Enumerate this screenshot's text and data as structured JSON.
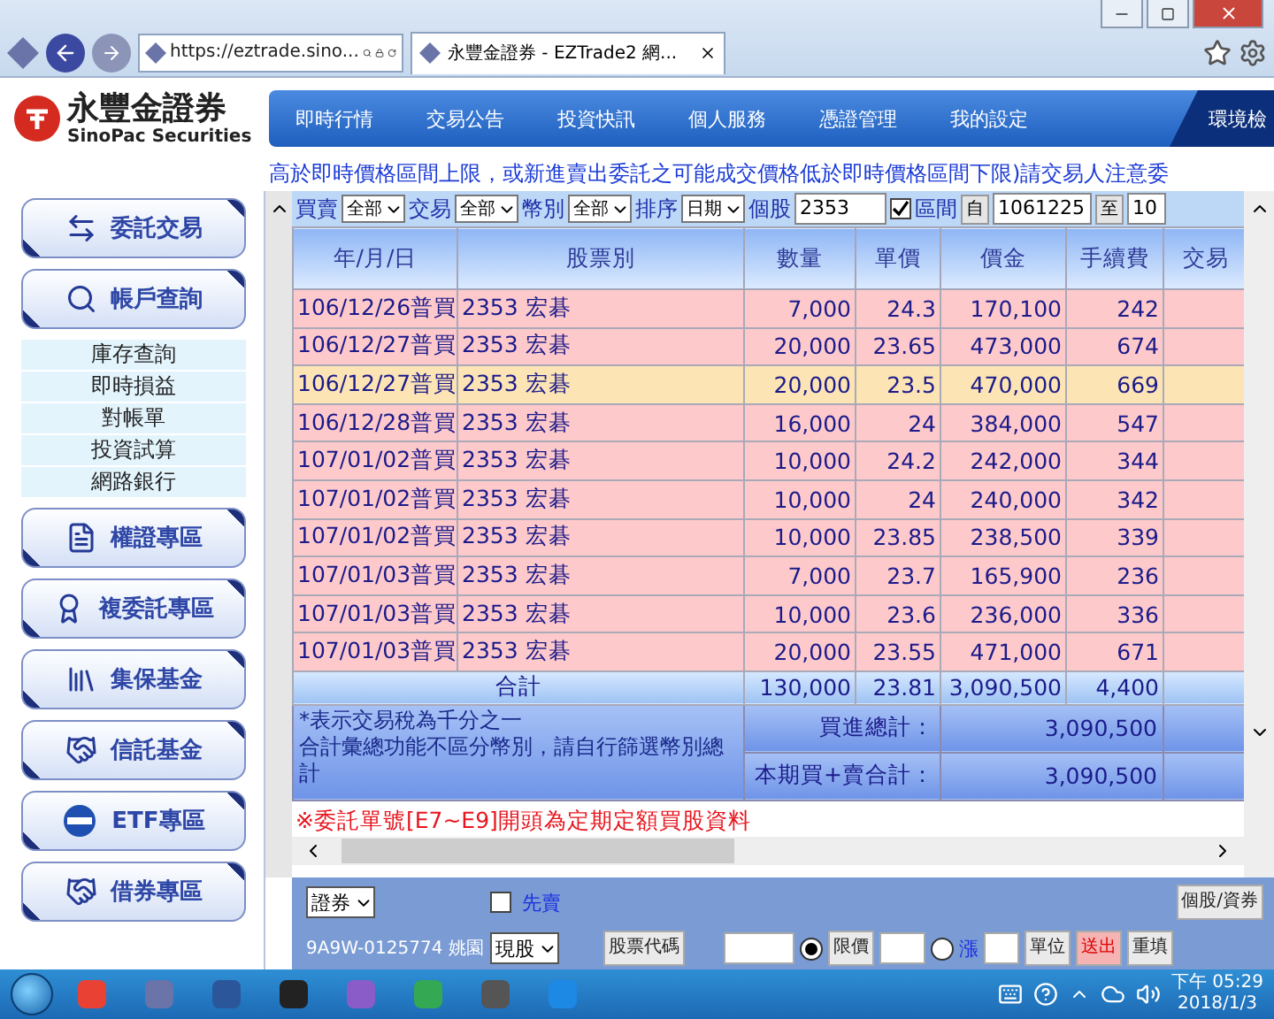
{
  "browser": {
    "url": "https://eztrade.sino...",
    "tab": "永豐金證券 - EZTrade2 網..."
  },
  "logo": {
    "name": "永豐金證券",
    "subtitle": "SinoPac Securities"
  },
  "nav": [
    {
      "label": "即時行情",
      "selected": false
    },
    {
      "label": "交易公告",
      "selected": false
    },
    {
      "label": "投資快訊",
      "selected": false
    },
    {
      "label": "個人服務",
      "selected": false
    },
    {
      "label": "憑證管理",
      "selected": false
    },
    {
      "label": "我的設定",
      "selected": false
    },
    {
      "label": "環境檢",
      "selected": true
    }
  ],
  "notice": "高於即時價格區間上限，或新進賣出委託之可能成交價格低於即時價格區間下限)請交易人注意委",
  "sidebar": [
    {
      "kind": "button",
      "label": "委託交易"
    },
    {
      "kind": "button",
      "label": "帳戶查詢"
    },
    {
      "kind": "submenu",
      "items": [
        "庫存查詢",
        "即時損益",
        "對帳單",
        "投資試算",
        "網路銀行"
      ]
    },
    {
      "kind": "button",
      "label": "權證專區"
    },
    {
      "kind": "button",
      "label": "複委託專區"
    },
    {
      "kind": "button",
      "label": "集保基金"
    },
    {
      "kind": "button",
      "label": "信託基金"
    },
    {
      "kind": "button",
      "label": "ETF專區"
    },
    {
      "kind": "button",
      "label": "借券專區"
    }
  ],
  "filters": [
    {
      "kind": "select",
      "label": "買賣",
      "value": "全部"
    },
    {
      "kind": "select",
      "label": "交易",
      "value": "全部"
    },
    {
      "kind": "select",
      "label": "幣別",
      "value": "全部"
    },
    {
      "kind": "select",
      "label": "排序",
      "value": "日期"
    },
    {
      "kind": "input",
      "label": "個股",
      "value": "2353"
    },
    {
      "kind": "checkbox",
      "label": "區間",
      "checked": true
    },
    {
      "kind": "button",
      "label": "自"
    },
    {
      "kind": "input",
      "value": "1061225"
    },
    {
      "kind": "button",
      "label": "至"
    },
    {
      "kind": "input",
      "value": "10"
    }
  ],
  "table": {
    "columns": [
      "年/月/日",
      "股票別",
      "數量",
      "單價",
      "價金",
      "手續費",
      "交易"
    ],
    "rows": [
      {
        "selected": false,
        "cells": [
          "106/12/26普買",
          "2353 宏碁",
          "7,000",
          "24.3",
          "170,100",
          "242"
        ]
      },
      {
        "selected": false,
        "cells": [
          "106/12/27普買",
          "2353 宏碁",
          "20,000",
          "23.65",
          "473,000",
          "674"
        ]
      },
      {
        "selected": true,
        "cells": [
          "106/12/27普買",
          "2353 宏碁",
          "20,000",
          "23.5",
          "470,000",
          "669"
        ]
      },
      {
        "selected": false,
        "cells": [
          "106/12/28普買",
          "2353 宏碁",
          "16,000",
          "24",
          "384,000",
          "547"
        ]
      },
      {
        "selected": false,
        "cells": [
          "107/01/02普買",
          "2353 宏碁",
          "10,000",
          "24.2",
          "242,000",
          "344"
        ]
      },
      {
        "selected": false,
        "cells": [
          "107/01/02普買",
          "2353 宏碁",
          "10,000",
          "24",
          "240,000",
          "342"
        ]
      },
      {
        "selected": false,
        "cells": [
          "107/01/02普買",
          "2353 宏碁",
          "10,000",
          "23.85",
          "238,500",
          "339"
        ]
      },
      {
        "selected": false,
        "cells": [
          "107/01/03普買",
          "2353 宏碁",
          "7,000",
          "23.7",
          "165,900",
          "236"
        ]
      },
      {
        "selected": false,
        "cells": [
          "107/01/03普買",
          "2353 宏碁",
          "10,000",
          "23.6",
          "236,000",
          "336"
        ]
      },
      {
        "selected": false,
        "cells": [
          "107/01/03普買",
          "2353 宏碁",
          "20,000",
          "23.55",
          "471,000",
          "671"
        ]
      }
    ],
    "total": {
      "label": "合計",
      "cells": [
        "130,000",
        "23.81",
        "3,090,500",
        "4,400"
      ]
    },
    "notes": [
      "*表示交易稅為千分之一",
      "合計彙總功能不區分幣別，請自行篩選幣別總計"
    ],
    "summary": [
      {
        "label": "買進總計：",
        "value": "3,090,500"
      },
      {
        "label": "本期買+賣合計：",
        "value": "3,090,500"
      }
    ]
  },
  "footnote": "※委託單號[E7~E9]開頭為定期定額買股資料",
  "order": {
    "market": "證券",
    "sell_first": {
      "label": "先賣",
      "checked": false
    },
    "quote_button": "個股/資券",
    "account": "9A9W-0125774 姚園",
    "type": "現股",
    "code_button": "股票代碼",
    "price_types": [
      {
        "label": "限價",
        "selected": true
      },
      {
        "label": "漲",
        "selected": false
      }
    ],
    "unit_button": "單位",
    "submit": "送出",
    "reset": "重填"
  },
  "taskbar": {
    "time": "下午 05:29",
    "date": "2018/1/3"
  }
}
